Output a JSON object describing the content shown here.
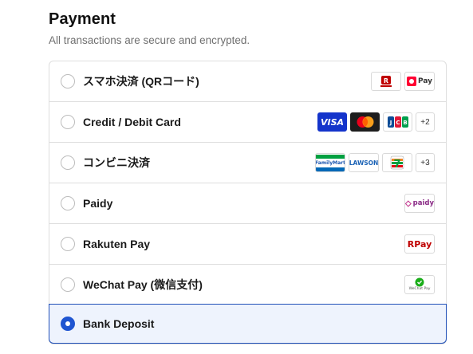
{
  "header": {
    "title": "Payment",
    "subtitle": "All transactions are secure and encrypted."
  },
  "options": [
    {
      "label": "スマホ決済 (QRコード)",
      "selected": false,
      "logos": [
        "rakuten-pay-app-icon",
        "paypay-icon"
      ],
      "logo_texts": {
        "paypay": "Pay",
        "rakuten_mini": "R Pay"
      }
    },
    {
      "label": "Credit / Debit Card",
      "selected": false,
      "logos": [
        "visa-icon",
        "mastercard-icon",
        "jcb-icon"
      ],
      "logo_texts": {
        "visa": "VISA",
        "jcb": "JCB"
      },
      "more": "+2"
    },
    {
      "label": "コンビニ決済",
      "selected": false,
      "logos": [
        "familymart-icon",
        "lawson-icon",
        "seven-eleven-icon"
      ],
      "logo_texts": {
        "familymart": "FamilyMart",
        "lawson": "LAWSON",
        "seven": "7"
      },
      "more": "+3"
    },
    {
      "label": "Paidy",
      "selected": false,
      "logos": [
        "paidy-icon"
      ],
      "logo_texts": {
        "paidy": "paidy"
      }
    },
    {
      "label": "Rakuten Pay",
      "selected": false,
      "logos": [
        "rakuten-pay-icon"
      ],
      "logo_texts": {
        "rpay": "Pay"
      }
    },
    {
      "label": "WeChat Pay (微信支付)",
      "selected": false,
      "logos": [
        "wechat-pay-icon"
      ],
      "logo_texts": {
        "wechat": "WeChat Pay"
      }
    },
    {
      "label": "Bank Deposit",
      "selected": true,
      "logos": []
    }
  ],
  "colors": {
    "accent": "#1f55d1",
    "selected_bg": "#eef3fd",
    "border": "#dedede"
  }
}
